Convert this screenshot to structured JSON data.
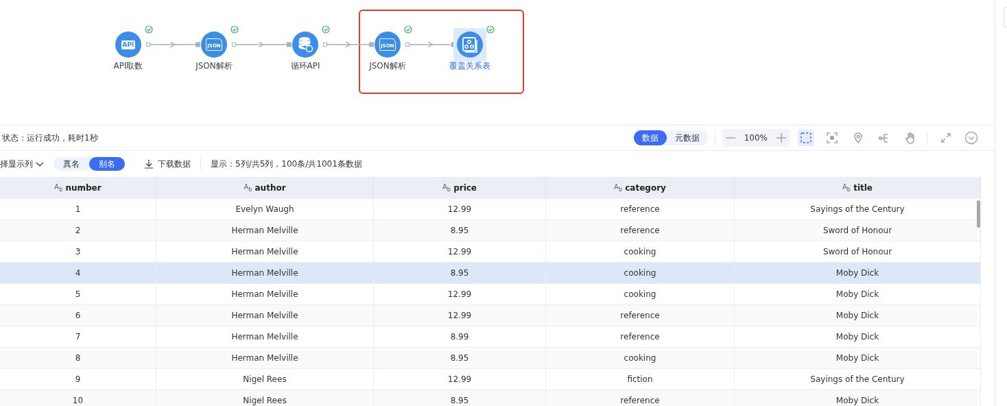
{
  "flow": {
    "nodes": [
      {
        "label": "API取数",
        "kind": "api",
        "icon_text": "API",
        "succeeded": true,
        "selected": false
      },
      {
        "label": "JSON解析",
        "kind": "doc",
        "icon_text": "JSON",
        "succeeded": true,
        "selected": false
      },
      {
        "label": "循环API",
        "kind": "db",
        "succeeded": true,
        "selected": false
      },
      {
        "label": "JSON解析",
        "kind": "doc",
        "icon_text": "JSON",
        "succeeded": true,
        "selected": false
      },
      {
        "label": "覆盖关系表",
        "kind": "table",
        "succeeded": true,
        "selected": true
      }
    ],
    "highlight_group": true
  },
  "status_bar": {
    "text": "状态：运行成功，耗时1秒",
    "views": [
      {
        "label": "数据",
        "selected": true
      },
      {
        "label": "元数据",
        "selected": false
      }
    ],
    "zoom": "100%",
    "tools": [
      {
        "kind": "select",
        "selected": true
      },
      {
        "kind": "fit",
        "selected": false
      },
      {
        "kind": "locate",
        "selected": false
      },
      {
        "kind": "tree",
        "selected": false
      },
      {
        "kind": "hand",
        "selected": false
      }
    ]
  },
  "table_toolbar": {
    "column_picker": "择显示列",
    "name_modes": [
      {
        "label": "真名",
        "selected": false
      },
      {
        "label": "别名",
        "selected": true
      }
    ],
    "download": "下载数据",
    "summary": "显示：5列/共5列，100条/共1001条数据"
  },
  "table": {
    "columns": [
      {
        "type": "A$_{b}$",
        "name": "number"
      },
      {
        "type": "A$_{b}$",
        "name": "author"
      },
      {
        "type": "A$_{b}$",
        "name": "price"
      },
      {
        "type": "A$_{b}$",
        "name": "category"
      },
      {
        "type": "A$_{b}$",
        "name": "title"
      }
    ],
    "rows": [
      {
        "selected": false,
        "cells": [
          "1",
          "Evelyn Waugh",
          "12.99",
          "reference",
          "Sayings of the Century"
        ]
      },
      {
        "selected": false,
        "cells": [
          "2",
          "Herman Melville",
          "8.95",
          "reference",
          "Sword of Honour"
        ]
      },
      {
        "selected": false,
        "cells": [
          "3",
          "Herman Melville",
          "12.99",
          "cooking",
          "Sword of Honour"
        ]
      },
      {
        "selected": true,
        "cells": [
          "4",
          "Herman Melville",
          "8.95",
          "cooking",
          "Moby Dick"
        ]
      },
      {
        "selected": false,
        "cells": [
          "5",
          "Herman Melville",
          "12.99",
          "cooking",
          "Moby Dick"
        ]
      },
      {
        "selected": false,
        "cells": [
          "6",
          "Herman Melville",
          "12.99",
          "reference",
          "Moby Dick"
        ]
      },
      {
        "selected": false,
        "cells": [
          "7",
          "Herman Melville",
          "8.99",
          "reference",
          "Moby Dick"
        ]
      },
      {
        "selected": false,
        "cells": [
          "8",
          "Herman Melville",
          "8.95",
          "cooking",
          "Moby Dick"
        ]
      },
      {
        "selected": false,
        "cells": [
          "9",
          "Nigel Rees",
          "12.99",
          "fiction",
          "Sayings of the Century"
        ]
      },
      {
        "selected": false,
        "cells": [
          "10",
          "Nigel Rees",
          "8.95",
          "reference",
          "Moby Dick"
        ]
      }
    ]
  }
}
